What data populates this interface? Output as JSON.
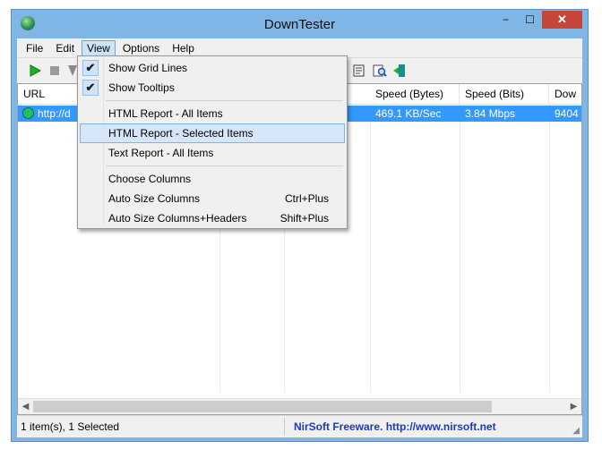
{
  "window": {
    "title": "DownTester",
    "controls": {
      "minimize": "−",
      "maximize": "☐",
      "close": "✕"
    }
  },
  "menubar": {
    "items": [
      {
        "label": "File"
      },
      {
        "label": "Edit"
      },
      {
        "label": "View"
      },
      {
        "label": "Options"
      },
      {
        "label": "Help"
      }
    ]
  },
  "toolbar": {
    "icons": [
      "play-icon",
      "stop-icon",
      "copy-icon",
      "report-icon",
      "find-icon",
      "exit-icon"
    ]
  },
  "table": {
    "columns": [
      {
        "label": "URL"
      },
      {
        "label": "Speed (Bytes)"
      },
      {
        "label": "Speed (Bits)"
      },
      {
        "label": "Dow"
      }
    ],
    "rows": [
      {
        "url": "http://d",
        "speed_bytes": "469.1 KB/Sec",
        "speed_bits": "3.84 Mbps",
        "dow": "9404"
      }
    ]
  },
  "view_menu": {
    "items": [
      {
        "label": "Show Grid Lines",
        "checked": true
      },
      {
        "label": "Show Tooltips",
        "checked": true
      },
      {
        "label": "HTML Report - All Items"
      },
      {
        "label": "HTML Report - Selected Items",
        "highlighted": true
      },
      {
        "label": "Text Report - All Items"
      },
      {
        "label": "Choose Columns"
      },
      {
        "label": "Auto Size Columns",
        "shortcut": "Ctrl+Plus"
      },
      {
        "label": "Auto Size Columns+Headers",
        "shortcut": "Shift+Plus"
      }
    ]
  },
  "statusbar": {
    "left": "1 item(s), 1 Selected",
    "right": "NirSoft Freeware.  http://www.nirsoft.net"
  },
  "colors": {
    "selection": "#3399ff",
    "window_frame": "#7fb6e6",
    "menu_highlight": "#d5e6f8",
    "status_link": "#1a3bbf"
  }
}
